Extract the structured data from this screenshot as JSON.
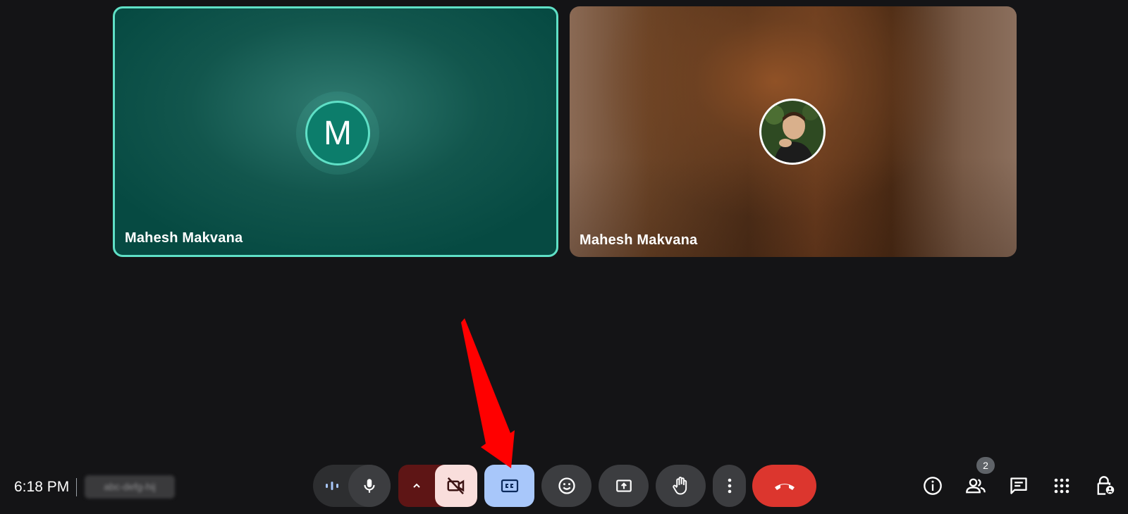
{
  "participants": [
    {
      "name": "Mahesh Makvana",
      "avatar_initial": "M",
      "speaking": true
    },
    {
      "name": "Mahesh Makvana",
      "avatar": "photo"
    }
  ],
  "footer": {
    "time": "6:18 PM",
    "meeting_code": "abc-defg-hij"
  },
  "controls": {
    "mic_level_icon": "audio-level-icon",
    "mic_icon": "microphone-icon",
    "camera_options_icon": "chevron-up-icon",
    "camera_icon": "camera-off-icon",
    "captions_icon": "closed-captions-icon",
    "reactions_icon": "emoji-icon",
    "present_icon": "present-screen-icon",
    "raise_hand_icon": "raise-hand-icon",
    "more_icon": "more-vert-icon",
    "end_call_icon": "end-call-icon"
  },
  "side_controls": {
    "info_icon": "info-icon",
    "people_icon": "people-icon",
    "people_count": "2",
    "chat_icon": "chat-icon",
    "activities_icon": "apps-grid-icon",
    "host_controls_icon": "lock-person-icon"
  },
  "colors": {
    "background": "#141416",
    "speaking_border": "#5fe0c6",
    "captions_active": "#a8c7fa",
    "end_call": "#dc362e",
    "camera_off": "#f9dedc",
    "annotation_arrow": "#ff0000"
  }
}
